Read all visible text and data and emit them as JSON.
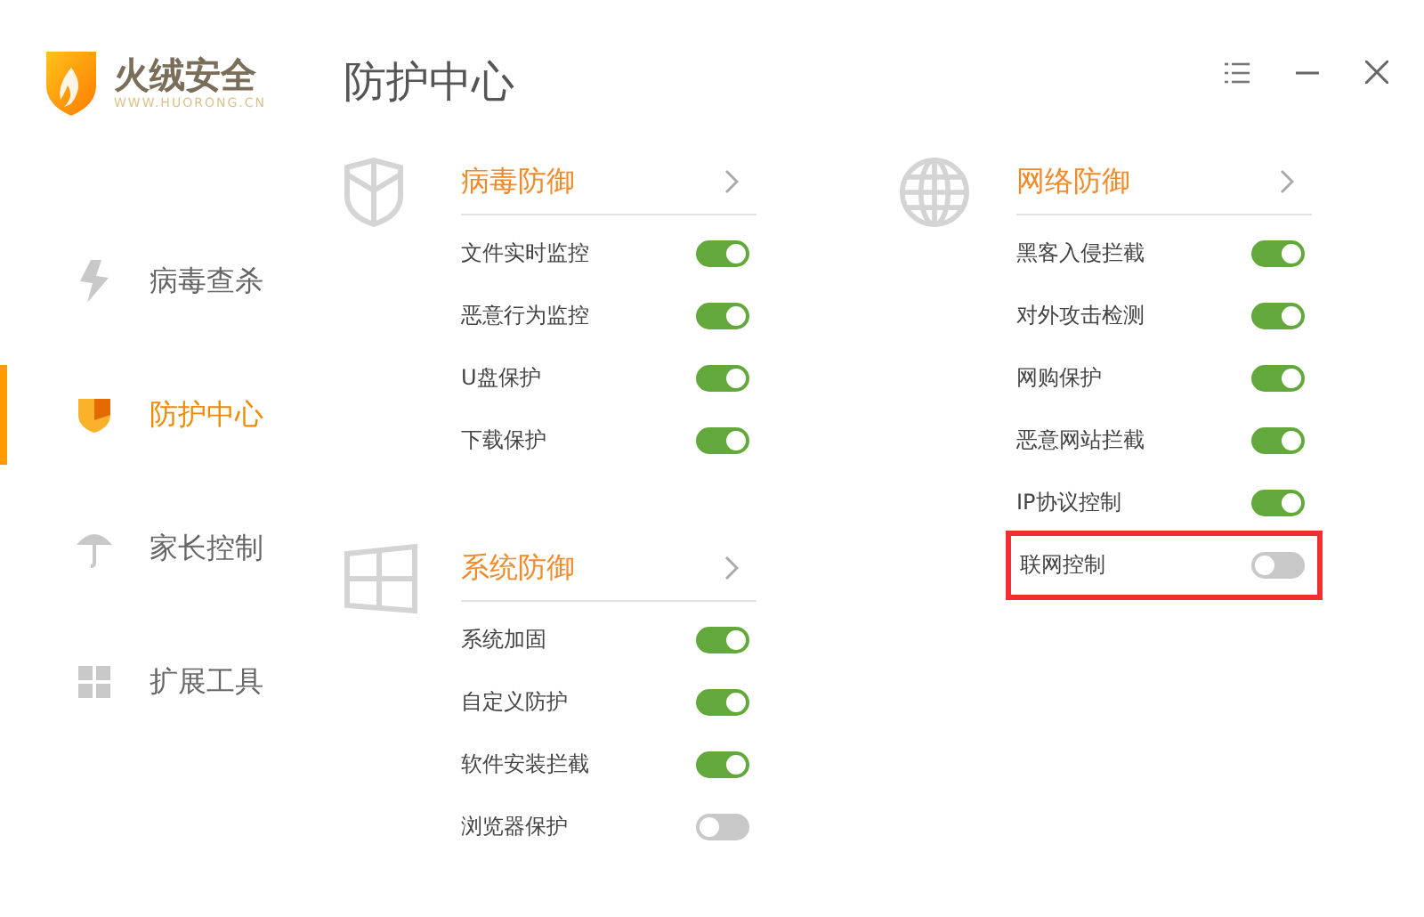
{
  "logo": {
    "name": "火绒安全",
    "url": "WWW.HUORONG.CN"
  },
  "title": "防护中心",
  "sidebar": {
    "items": [
      {
        "label": "病毒查杀",
        "kind": "bolt",
        "selected": false
      },
      {
        "label": "防护中心",
        "kind": "shield",
        "selected": true
      },
      {
        "label": "家长控制",
        "kind": "umbrella",
        "selected": false
      },
      {
        "label": "扩展工具",
        "kind": "grid",
        "selected": false
      }
    ]
  },
  "columns": [
    {
      "sections": [
        {
          "title": "病毒防御",
          "kind": "shield",
          "items": [
            {
              "label": "文件实时监控",
              "on": true,
              "highlighted": false
            },
            {
              "label": "恶意行为监控",
              "on": true,
              "highlighted": false
            },
            {
              "label": "U盘保护",
              "on": true,
              "highlighted": false
            },
            {
              "label": "下载保护",
              "on": true,
              "highlighted": false
            }
          ]
        },
        {
          "title": "系统防御",
          "kind": "window",
          "items": [
            {
              "label": "系统加固",
              "on": true,
              "highlighted": false
            },
            {
              "label": "自定义防护",
              "on": true,
              "highlighted": false
            },
            {
              "label": "软件安装拦截",
              "on": true,
              "highlighted": false
            },
            {
              "label": "浏览器保护",
              "on": false,
              "highlighted": false
            }
          ]
        }
      ]
    },
    {
      "sections": [
        {
          "title": "网络防御",
          "kind": "globe",
          "items": [
            {
              "label": "黑客入侵拦截",
              "on": true,
              "highlighted": false
            },
            {
              "label": "对外攻击检测",
              "on": true,
              "highlighted": false
            },
            {
              "label": "网购保护",
              "on": true,
              "highlighted": false
            },
            {
              "label": "恶意网站拦截",
              "on": true,
              "highlighted": false
            },
            {
              "label": "IP协议控制",
              "on": true,
              "highlighted": false
            },
            {
              "label": "联网控制",
              "on": false,
              "highlighted": true
            }
          ]
        }
      ]
    }
  ]
}
